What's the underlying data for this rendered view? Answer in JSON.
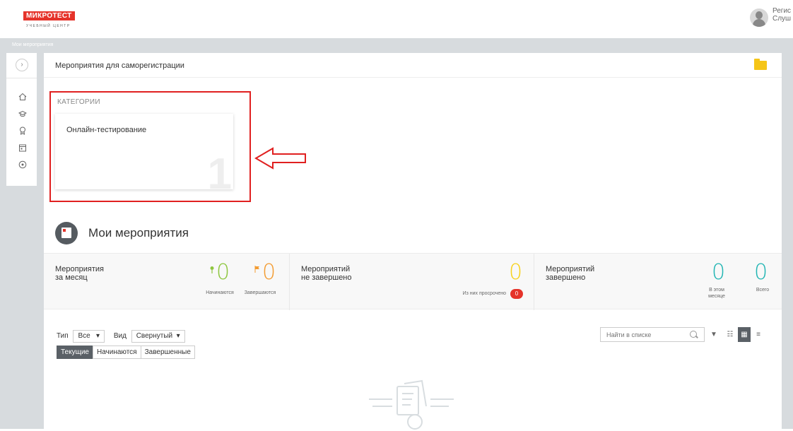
{
  "header": {
    "logo_text": "МИКРОТЕСТ",
    "logo_sub": "УЧЕБНЫЙ ЦЕНТР",
    "user_line1": "Регис",
    "user_line2": "Слуш"
  },
  "breadcrumb": "Мои мероприятия",
  "sidebar": {
    "toggle": "›",
    "icons": [
      "home-icon",
      "graduation-cap-icon",
      "award-icon",
      "calendar-icon",
      "play-circle-icon"
    ]
  },
  "main": {
    "header_title": "Мероприятия для саморегистрации",
    "categories": {
      "label": "КАТЕГОРИИ",
      "items": [
        {
          "name": "Онлайн-тестирование",
          "count": "1"
        }
      ]
    },
    "section_title": "Мои мероприятия",
    "stats": {
      "month": {
        "label_line1": "Мероприятия",
        "label_line2": "за месяц",
        "starting_value": "0",
        "starting_label": "Начинаются",
        "ending_value": "0",
        "ending_label": "Завершаются"
      },
      "unfinished": {
        "label_line1": "Мероприятий",
        "label_line2": "не завершено",
        "value": "0",
        "overdue_label": "Из них просрочено",
        "overdue_value": "0"
      },
      "finished": {
        "label_line1": "Мероприятий",
        "label_line2": "завершено",
        "month_value": "0",
        "month_label_line1": "В этом",
        "month_label_line2": "месяце",
        "total_value": "0",
        "total_label": "Всего"
      }
    },
    "filters": {
      "type_label": "Тип",
      "type_value": "Все",
      "view_label": "Вид",
      "view_value": "Свернутый",
      "tabs": [
        "Текущие",
        "Начинаются",
        "Завершенные"
      ]
    },
    "search": {
      "placeholder": "Найти в списке"
    }
  },
  "colors": {
    "brand_red": "#e5332a",
    "green": "#8ec63f",
    "orange": "#f39c32",
    "yellow": "#f7d11b",
    "teal": "#21b5b3"
  }
}
